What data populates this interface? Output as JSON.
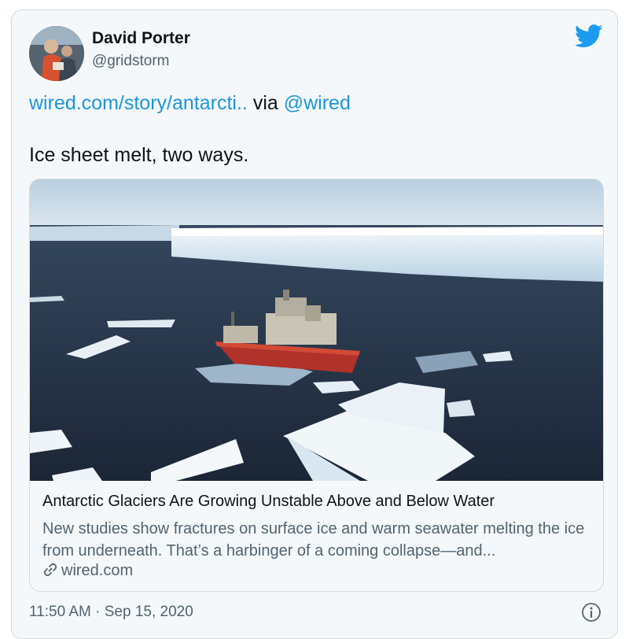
{
  "author": {
    "display_name": "David Porter",
    "handle": "@gridstorm"
  },
  "tweet": {
    "link_text": "wired.com/story/antarcti..",
    "via_text": "via",
    "mention": "@wired",
    "body": "Ice sheet melt, two ways."
  },
  "link_card": {
    "title": "Antarctic Glaciers Are Growing Unstable Above and Below Water",
    "description": "New studies show fractures on surface ice and warm seawater melting the ice from underneath. That’s a harbinger of a coming collapse—and...",
    "domain": "wired.com"
  },
  "timestamp": "11:50 AM · Sep 15, 2020",
  "icons": {
    "brand": "twitter-bird-icon",
    "link": "link-icon",
    "info": "info-icon"
  },
  "colors": {
    "link": "#1b95e0",
    "brand": "#1d9bf0",
    "muted": "#536471",
    "text": "#0f1419",
    "card_bg": "#f5f8fa"
  }
}
